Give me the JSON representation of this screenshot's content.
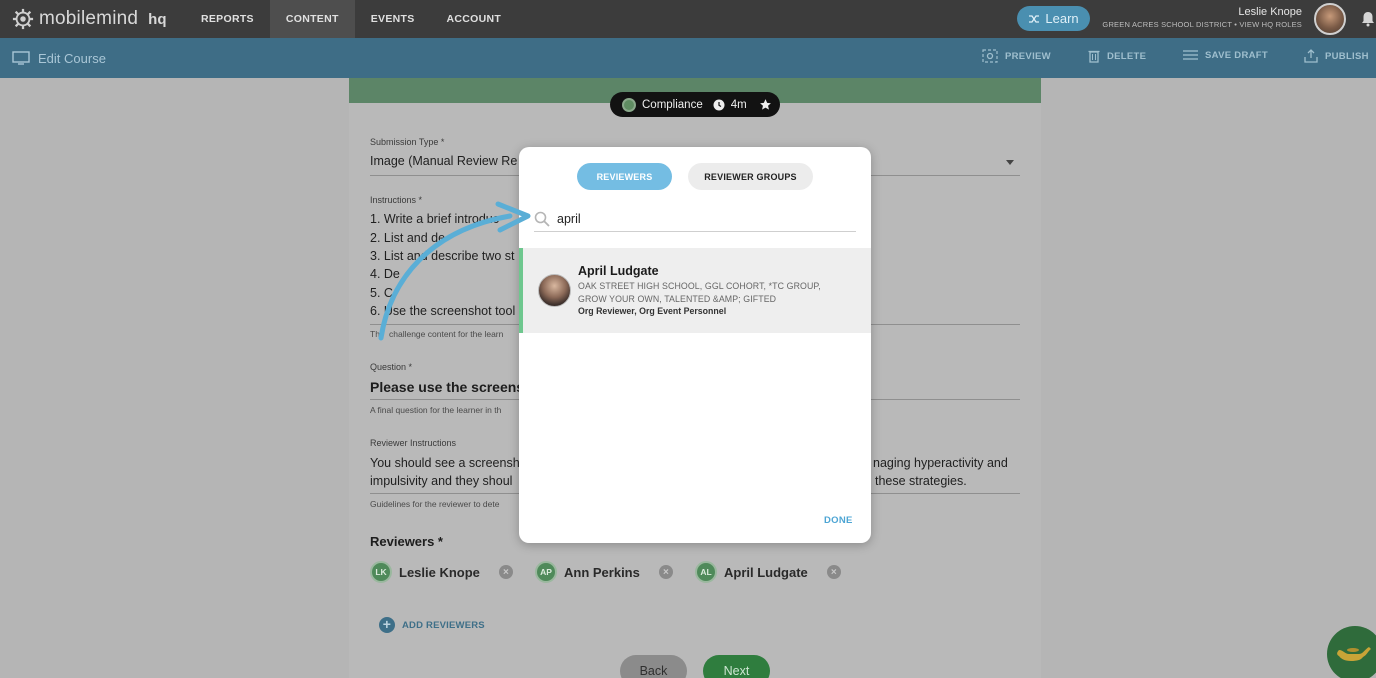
{
  "topnav": {
    "brand": "mobilemind",
    "brand_sub": "hq",
    "items": [
      {
        "label": "REPORTS"
      },
      {
        "label": "CONTENT"
      },
      {
        "label": "EVENTS"
      },
      {
        "label": "ACCOUNT"
      }
    ],
    "learn_label": "Learn",
    "user_name": "Leslie Knope",
    "user_sub": "GREEN ACRES SCHOOL DISTRICT • VIEW HQ ROLES"
  },
  "subbar": {
    "title": "Edit Course",
    "preview": "PREVIEW",
    "delete": "DELETE",
    "save_draft": "SAVE DRAFT",
    "publish": "PUBLISH"
  },
  "course": {
    "category": "Compliance",
    "duration": "4m",
    "submission_type_label": "Submission Type *",
    "submission_type_value": "Image (Manual Review Re",
    "instructions_label": "Instructions *",
    "instructions": [
      "1. Write a brief introduc",
      "2. List and de",
      "3. List and describe two st",
      "4. De",
      "5. C",
      "6. Use the screenshot tool"
    ],
    "instructions_hint": "Th",
    "instructions_hint2": "challenge content for the learn",
    "question_label": "Question *",
    "question_value": "Please use the screens",
    "question_hint": "A final question for the learner in th",
    "reviewer_instructions_label": "Reviewer Instructions",
    "reviewer_instructions_line1": "You should see a screensh",
    "reviewer_instructions_line1_end": "naging hyperactivity and",
    "reviewer_instructions_line2": "impulsivity and they shoul",
    "reviewer_instructions_line2_end": "these strategies.",
    "reviewer_instructions_hint": "Guidelines for the reviewer to dete",
    "reviewers_title": "Reviewers *",
    "reviewers": [
      {
        "initials": "LK",
        "name": "Leslie Knope"
      },
      {
        "initials": "AP",
        "name": "Ann Perkins"
      },
      {
        "initials": "AL",
        "name": "April Ludgate"
      }
    ],
    "add_reviewers": "ADD REVIEWERS",
    "back": "Back",
    "next": "Next"
  },
  "modal": {
    "tab_reviewers": "REVIEWERS",
    "tab_groups": "REVIEWER GROUPS",
    "search_value": "april",
    "result": {
      "name": "April Ludgate",
      "orgs": "OAK STREET HIGH SCHOOL, GGL COHORT, *TC GROUP, GROW YOUR OWN, TALENTED &AMP; GIFTED",
      "roles": "Org Reviewer, Org Event Personnel"
    },
    "done": "DONE"
  },
  "colors": {
    "accent": "#74bde3",
    "nav_bg": "#3c3c3c",
    "subbar_bg": "#3e6d86",
    "reviewer_green": "#4f8a5a",
    "annotation_arrow": "#5aaed6"
  }
}
